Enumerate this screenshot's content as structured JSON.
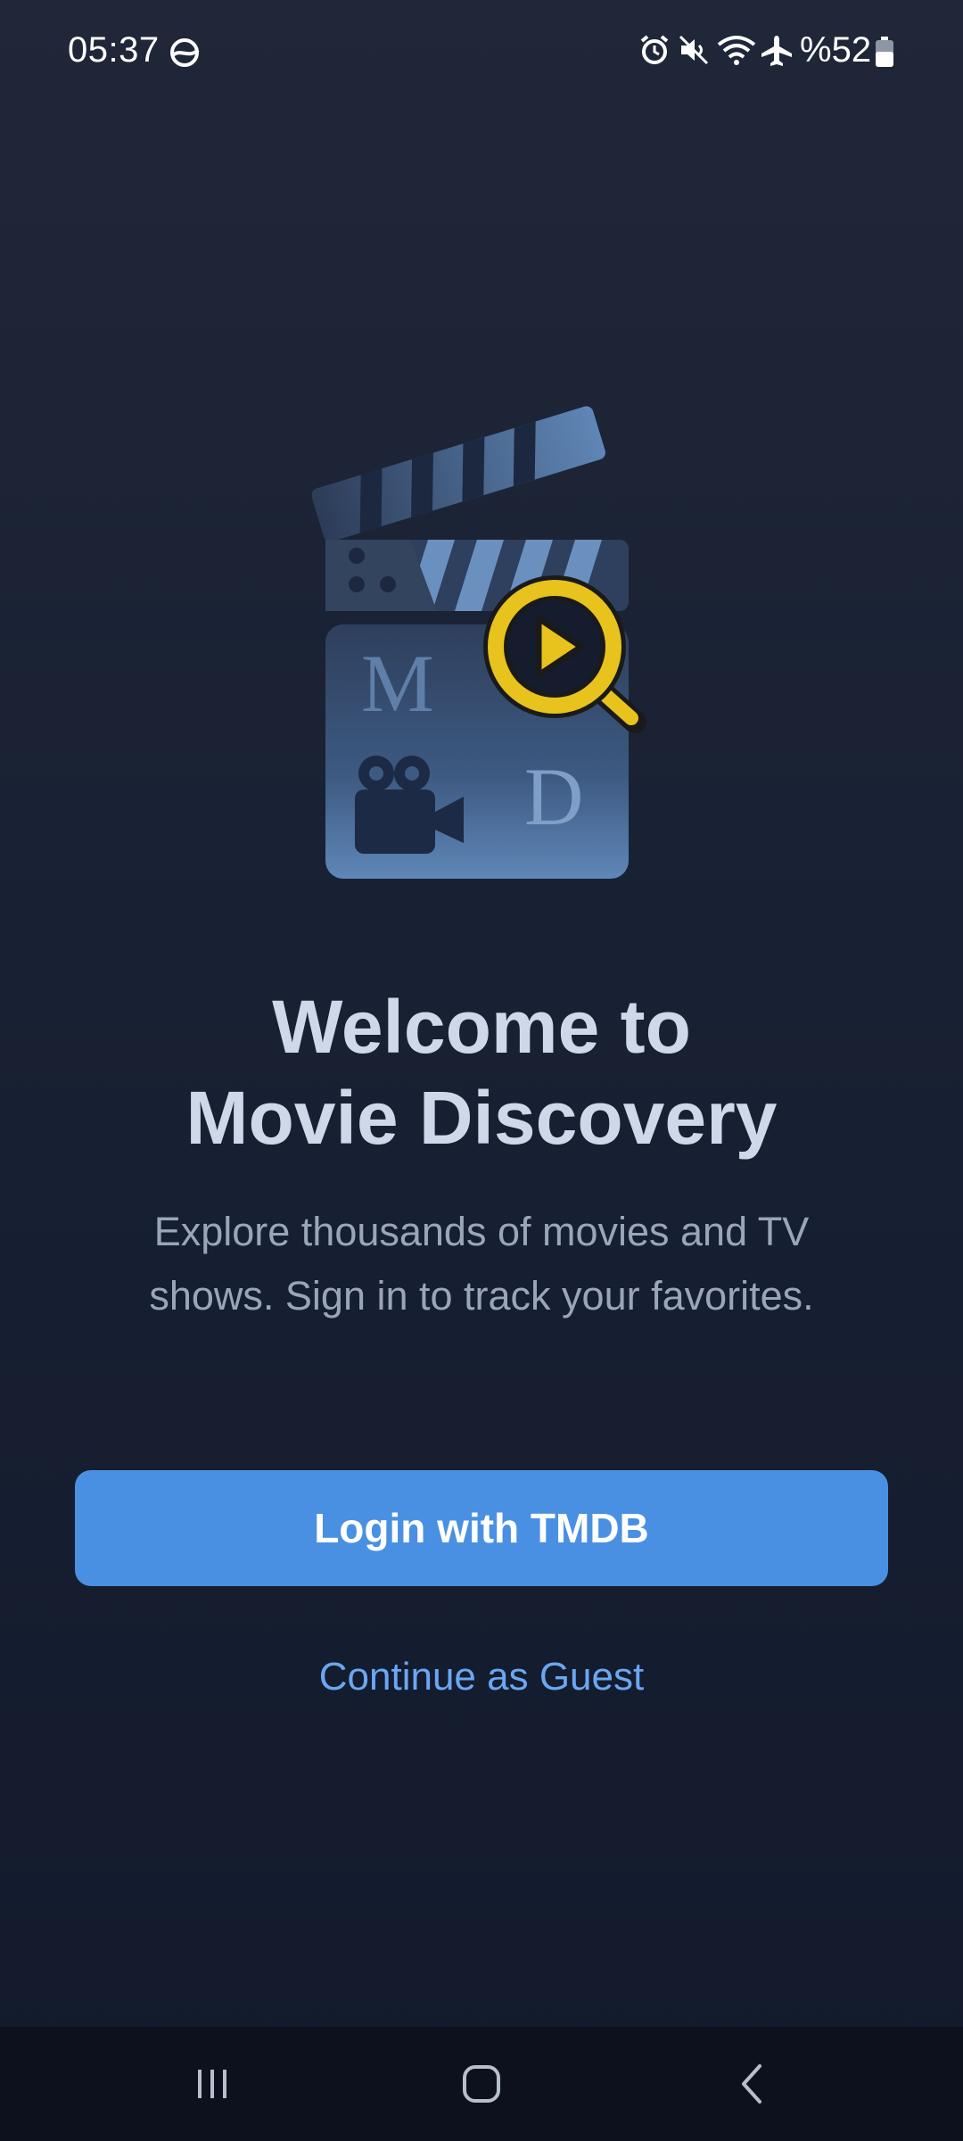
{
  "status_bar": {
    "time": "05:37",
    "battery": "%52",
    "icons": [
      "sync-icon",
      "alarm-icon",
      "mute-icon",
      "wifi-icon",
      "airplane-icon",
      "battery-icon"
    ]
  },
  "logo": {
    "letter_m": "M",
    "letter_d": "D",
    "icons": [
      "clapperboard-icon",
      "magnifier-play-icon",
      "movie-camera-icon"
    ]
  },
  "welcome": {
    "title_line1": "Welcome to",
    "title_line2": "Movie Discovery",
    "subtitle_line1": "Explore thousands of movies and TV",
    "subtitle_line2": "shows. Sign in to track your favorites."
  },
  "actions": {
    "login_label": "Login with TMDB",
    "guest_label": "Continue as Guest"
  },
  "nav_bar": {
    "icons": [
      "recent-apps-icon",
      "home-icon",
      "back-icon"
    ]
  },
  "colors": {
    "accent": "#4a90e2",
    "link": "#6aa7f2",
    "magnifier": "#e8c21d",
    "background_top": "#1f2738",
    "background_bottom": "#121a2c"
  }
}
